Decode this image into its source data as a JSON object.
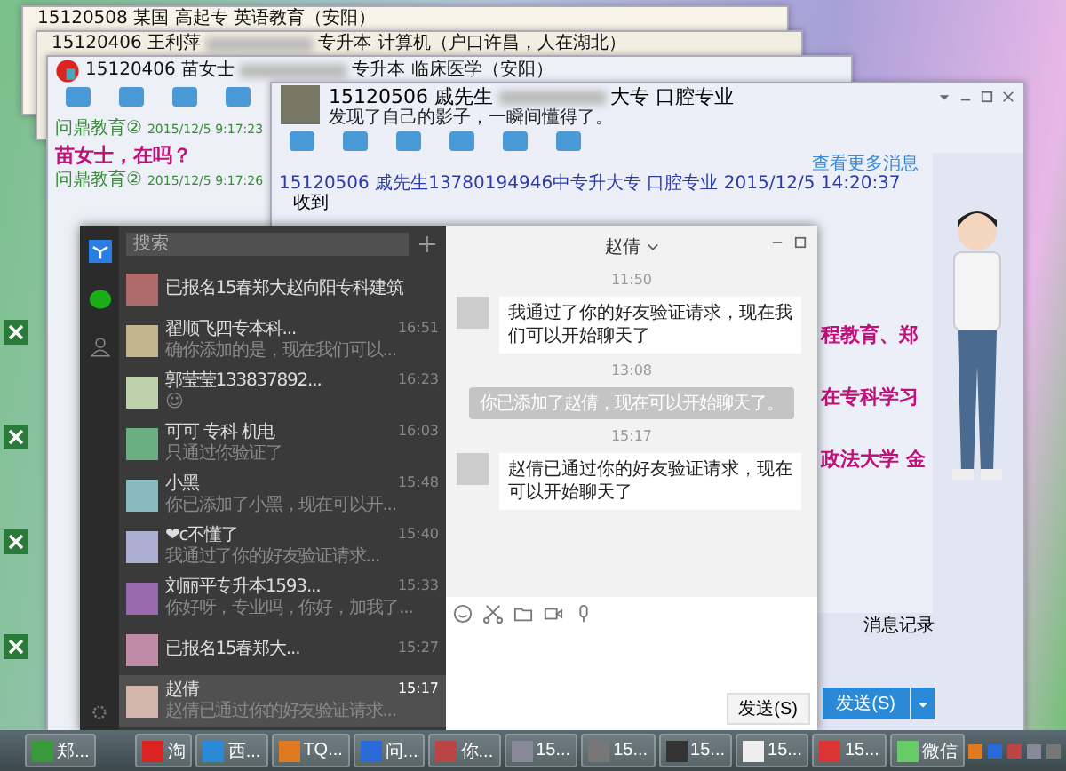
{
  "back_windows": [
    {
      "title": "15120508 某国 高起专 英语教育（安阳）"
    },
    {
      "title": "15120406 王利萍",
      "title_tail": "专升本 计算机（户口许昌，人在湖北）"
    }
  ],
  "qq_behind": {
    "title": "15120406 苗女士",
    "title_tail": "专升本 临床医学（安阳）",
    "messages": [
      {
        "sender": "问鼎教育②",
        "time": "2015/12/5 9:17:23",
        "text": "苗女士，在吗？"
      },
      {
        "sender": "问鼎教育②",
        "time": "2015/12/5 9:17:26"
      }
    ]
  },
  "qq_window": {
    "title": "15120506 戚先生",
    "title_tail": "大专 口腔专业",
    "signature": "发现了自己的影子，一瞬间懂得了。",
    "more_link": "查看更多消息",
    "messages": [
      {
        "sender": "15120506 戚先生13780194946中专升大专 口腔专业 2015/12/5 14:20:37",
        "text": "收到"
      }
    ],
    "partial_lines": [
      "程教育、郑",
      "在专科学习",
      "政法大学  金"
    ],
    "history_button": "消息记录",
    "send_button": "发送(S)"
  },
  "wechat": {
    "nav": [
      {
        "kind": "chat",
        "selected": true
      },
      {
        "kind": "contacts",
        "selected": false
      }
    ],
    "search": {
      "placeholder": "搜索"
    },
    "chats": [
      {
        "name": "已报名15春郑大赵向阳专科建筑",
        "selected": false
      },
      {
        "name": "翟顺飞四专本科...",
        "time": "16:51",
        "preview": "确你添加的是，现在我们可以...",
        "selected": false
      },
      {
        "name": "郭莹莹133837892...",
        "time": "16:23",
        "preview": "☺",
        "selected": false
      },
      {
        "name": "可可  专科 机电",
        "time": "16:03",
        "preview": "只通过你验证了",
        "selected": false
      },
      {
        "name": "小黑",
        "time": "15:48",
        "preview": "你已添加了小黑，现在可以开...",
        "selected": false
      },
      {
        "name": "❤c不懂了",
        "time": "15:40",
        "preview": "我通过了你的好友验证请求...",
        "selected": false
      },
      {
        "name": "刘丽平专升本1593...",
        "time": "15:33",
        "preview": "你好呀，专业吗，你好，加我了...",
        "selected": false
      },
      {
        "name": "已报名15春郑大...",
        "time": "15:27",
        "selected": false
      },
      {
        "name": "赵倩",
        "time": "15:17",
        "preview": "赵倩已通过你的好友验证请求...",
        "selected": true
      }
    ],
    "conversation": {
      "title": "赵倩",
      "messages": [
        {
          "kind": "time",
          "text": "11:50"
        },
        {
          "kind": "incoming",
          "text": "我通过了你的好友验证请求，现在我们可以开始聊天了"
        },
        {
          "kind": "time",
          "text": "13:08"
        },
        {
          "kind": "system",
          "text": "你已添加了赵倩，现在可以开始聊天了。"
        },
        {
          "kind": "time",
          "text": "15:17"
        },
        {
          "kind": "incoming",
          "text": "赵倩已通过你的好友验证请求，现在可以开始聊天了"
        }
      ]
    },
    "send_button": "发送(S)"
  },
  "taskbar": {
    "items": [
      {
        "kind": "app",
        "label": "郑..."
      },
      {
        "kind": "icon"
      },
      {
        "kind": "icon"
      },
      {
        "kind": "app",
        "label": "淘"
      },
      {
        "kind": "app",
        "label": "西..."
      },
      {
        "kind": "app",
        "label": "TQ..."
      },
      {
        "kind": "app",
        "label": "问..."
      },
      {
        "kind": "app",
        "label": "你..."
      },
      {
        "kind": "app",
        "label": "15..."
      },
      {
        "kind": "app",
        "label": "15..."
      },
      {
        "kind": "app",
        "label": "15..."
      },
      {
        "kind": "app",
        "label": "15..."
      },
      {
        "kind": "app",
        "label": "15..."
      },
      {
        "kind": "app",
        "label": "微信"
      }
    ]
  }
}
